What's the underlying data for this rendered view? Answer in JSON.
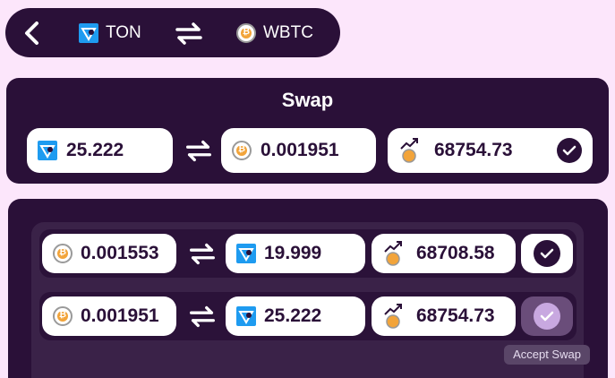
{
  "pair": {
    "from": "TON",
    "to": "WBTC"
  },
  "swap": {
    "title": "Swap",
    "ton_amount": "25.222",
    "btc_amount": "0.001951",
    "rate": "68754.73"
  },
  "offers": [
    {
      "btc_amount": "0.001553",
      "ton_amount": "19.999",
      "rate": "68708.58"
    },
    {
      "btc_amount": "0.001951",
      "ton_amount": "25.222",
      "rate": "68754.73"
    }
  ],
  "tooltip": "Accept Swap",
  "icons": {
    "back": "chevron-left-icon",
    "swap": "swap-arrows-icon",
    "ton": "ton-logo-icon",
    "btc": "bitcoin-icon",
    "rate": "rate-trend-icon",
    "check": "check-icon"
  },
  "colors": {
    "background": "#fce6fb",
    "panel": "#2a1038",
    "ton": "#1e9bf0",
    "btc": "#f2a43a",
    "accept_active": "#ffffff",
    "accept_hover": "#c8a8e0"
  }
}
